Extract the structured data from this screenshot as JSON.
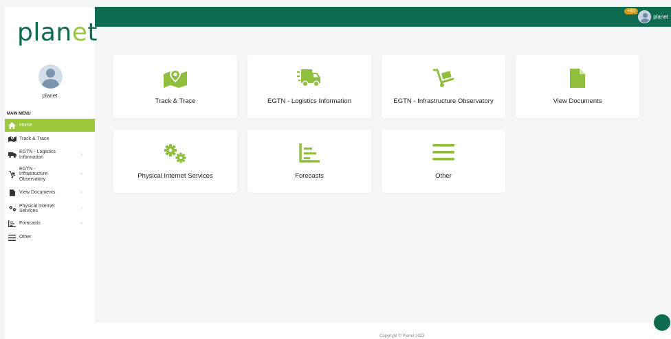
{
  "app": {
    "logo_main": "plan",
    "logo_e": "e",
    "logo_end": "t",
    "collapse_symbol": "«"
  },
  "header": {
    "notification_badge": "+60",
    "username": "planet"
  },
  "sidebar": {
    "username": "planet",
    "menu_heading": "MAIN MENU",
    "items": [
      {
        "label": "Home",
        "icon": "home-icon",
        "active": true
      },
      {
        "label": "Track & Trace",
        "icon": "map-pin-icon"
      },
      {
        "label": "EGTN - Logistics Information",
        "icon": "truck-icon",
        "chevron": true
      },
      {
        "label": "EGTN - Infrastructure Observatory",
        "icon": "cart-icon",
        "chevron": true
      },
      {
        "label": "View Documents",
        "icon": "document-icon",
        "chevron": true
      },
      {
        "label": "Physical Internet Services",
        "icon": "gears-icon",
        "chevron": true
      },
      {
        "label": "Forecasts",
        "icon": "chart-icon",
        "chevron": true
      },
      {
        "label": "Other",
        "icon": "bars-icon"
      }
    ]
  },
  "cards": [
    {
      "label": "Track & Trace",
      "icon": "map-pin-icon"
    },
    {
      "label": "EGTN - Logistics Information",
      "icon": "truck-icon"
    },
    {
      "label": "EGTN - Infrastructure Observatory",
      "icon": "cart-icon"
    },
    {
      "label": "View Documents",
      "icon": "document-icon"
    },
    {
      "label": "Physical Internet Services",
      "icon": "gears-icon"
    },
    {
      "label": "Forecasts",
      "icon": "chart-icon"
    },
    {
      "label": "Other",
      "icon": "bars-icon"
    }
  ],
  "footer": {
    "copyright": "Copyright © Planet 2023"
  },
  "colors": {
    "primary": "#0e6b4f",
    "accent": "#9cc83e",
    "background": "#f4f5f7",
    "badge": "#d69b1f"
  }
}
